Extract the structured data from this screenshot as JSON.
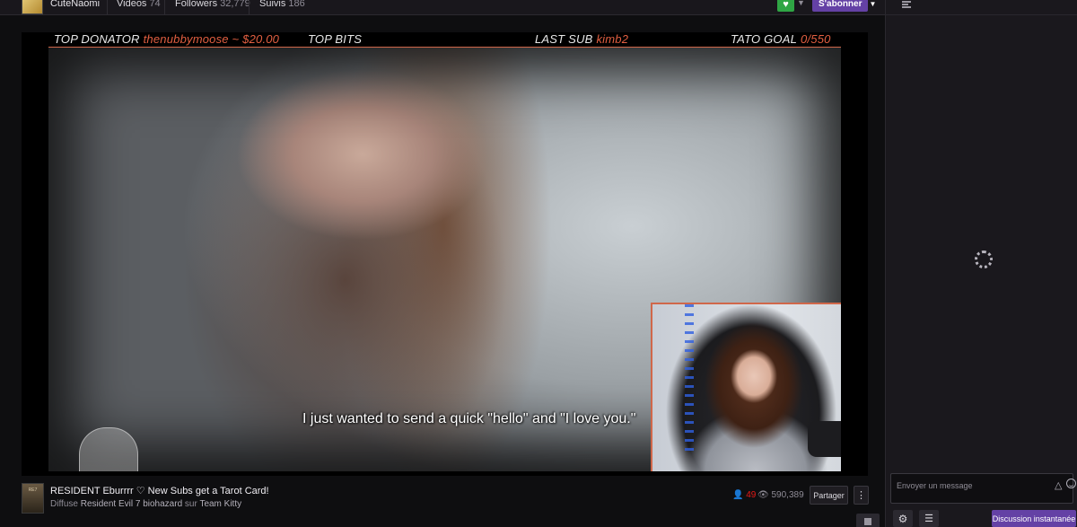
{
  "channel": {
    "name": "CuteNaomi",
    "tabs": [
      {
        "label": "Videos",
        "count": "74"
      },
      {
        "label": "Followers",
        "count": "32,779"
      },
      {
        "label": "Suivis",
        "count": "186"
      }
    ],
    "follow_icon": "heart-icon",
    "subscribe_label": "S'abonner"
  },
  "overlay": {
    "top_donator_label": "TOP DONATOR",
    "top_donator_value": "thenubbymoose ~ $20.00",
    "top_bits_label": "TOP BITS",
    "last_sub_label": "LAST SUB",
    "last_sub_value": "kimb2",
    "goal_label": "TATO GOAL",
    "goal_value": "0/550",
    "accent_color": "#e25f41"
  },
  "video": {
    "subtitle": "I just wanted to send a quick \"hello\" and \"I love you.\""
  },
  "stream_info": {
    "title": "RESIDENT Eburrrr ♡ New Subs get a Tarot Card!",
    "meta_prefix": "Diffuse",
    "game": "Resident Evil 7 biohazard",
    "meta_mid": "sur",
    "team": "Team Kitty",
    "viewers": "49",
    "views": "590,389",
    "share_label": "Partager",
    "more_label": "⋮"
  },
  "chat": {
    "placeholder": "Envoyer un message",
    "send_label": "Discussion instantanée",
    "send_color": "#6441a5"
  }
}
